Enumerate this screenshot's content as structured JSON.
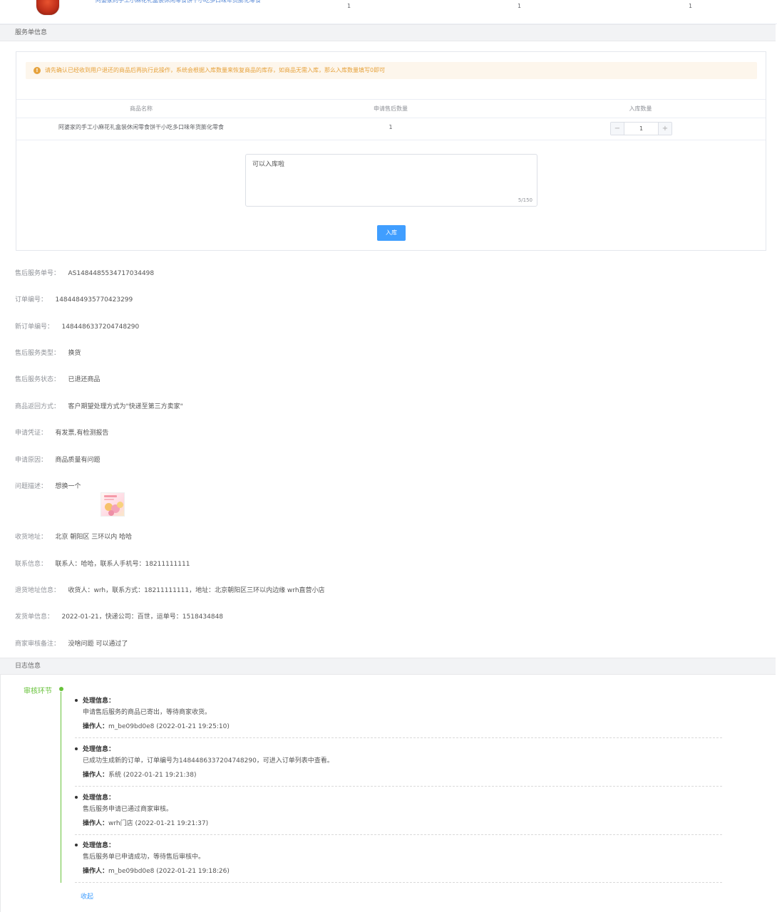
{
  "top_product": {
    "name": "阿婆家的手工小麻花礼盒装休闲零食饼干小吃多口味年货膨化零食",
    "qty1": "1",
    "qty2": "1",
    "qty3": "1"
  },
  "sections": {
    "service_info": "服务单信息",
    "log_info": "日志信息"
  },
  "inbound": {
    "alert": "请先确认已经收到用户退还的商品后再执行此操作，系统会根据入库数量来恢复商品的库存，如商品无需入库，那么入库数量填写0即可",
    "columns": [
      "商品名称",
      "申请售后数量",
      "入库数量"
    ],
    "row": {
      "name": "阿婆家的手工小麻花礼盒装休闲零食饼干小吃多口味年货膨化零食",
      "apply_qty": "1",
      "inbound_qty": "1"
    },
    "stepper_minus": "−",
    "stepper_plus": "+",
    "remark": "可以入库啦",
    "remark_count": "5/150",
    "submit_label": "入库"
  },
  "details": [
    {
      "label": "售后服务单号：",
      "value": "AS1484485534717034498"
    },
    {
      "label": "订单编号：",
      "value": "1484484935770423299"
    },
    {
      "label": "新订单编号：",
      "value": "1484486337204748290"
    },
    {
      "label": "售后服务类型：",
      "value": "换货"
    },
    {
      "label": "售后服务状态：",
      "value": "已退还商品"
    },
    {
      "label": "商品返回方式：",
      "value": "客户期望处理方式为\"快递至第三方卖家\""
    },
    {
      "label": "申请凭证：",
      "value": "有发票,有检测报告"
    },
    {
      "label": "申请原因：",
      "value": "商品质量有问题"
    },
    {
      "label": "问题描述：",
      "value": "想换一个"
    },
    {
      "label": "收货地址：",
      "value": "北京 朝阳区 三环以内 哈哈"
    },
    {
      "label": "联系信息：",
      "value": "联系人：哈哈，联系人手机号：18211111111"
    },
    {
      "label": "退货地址信息：",
      "value": "收货人：wrh，联系方式：18211111111，地址：北京朝阳区三环以内边缘 wrh直营小店"
    },
    {
      "label": "发货单信息：",
      "value": "2022-01-21，快递公司：百世，运单号：1518434848"
    },
    {
      "label": "商家审核备注：",
      "value": "没啥问题 可以通过了"
    }
  ],
  "log": {
    "stage": "审核环节",
    "items": [
      {
        "title": "处理信息：",
        "text": "申请售后服务的商品已寄出，等待商家收货。",
        "op_label": "操作人：",
        "op_value": "m_be09bd0e8 (2022-01-21 19:25:10)"
      },
      {
        "title": "处理信息：",
        "text": "已成功生成新的订单，订单编号为1484486337204748290，可进入订单列表中查看。",
        "op_label": "操作人：",
        "op_value": "系统 (2022-01-21 19:21:38)"
      },
      {
        "title": "处理信息：",
        "text": "售后服务申请已通过商家审核。",
        "op_label": "操作人：",
        "op_value": "wrh门店 (2022-01-21 19:21:37)"
      },
      {
        "title": "处理信息：",
        "text": "售后服务单已申请成功，等待售后审核中。",
        "op_label": "操作人：",
        "op_value": "m_be09bd0e8 (2022-01-21 19:18:26)"
      }
    ],
    "collapse": "收起"
  },
  "colors": {
    "primary": "#409eff",
    "warning": "#e6a23c",
    "success": "#67c23a"
  }
}
